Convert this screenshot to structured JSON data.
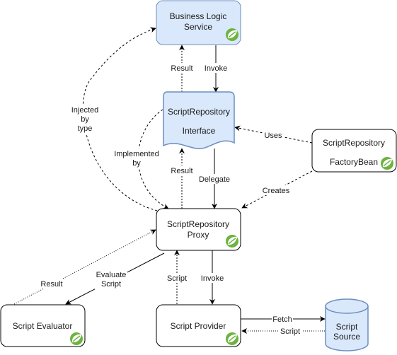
{
  "colors": {
    "blue_fill": "#dae8fc",
    "blue_stroke": "#6c8ebf",
    "white_fill": "#ffffff",
    "black_stroke": "#000000",
    "spring_green": "#6db33f"
  },
  "nodes": {
    "business_logic_service": {
      "line1": "Business Logic",
      "line2": "Service",
      "icon": "spring-leaf-icon"
    },
    "script_repository_interface": {
      "line1": "ScriptRepository",
      "line2": "Interface"
    },
    "script_repository_factory_bean": {
      "line1": "ScriptRepository",
      "line2": "FactoryBean",
      "icon": "spring-leaf-icon"
    },
    "script_repository_proxy": {
      "line1": "ScriptRepository",
      "line2": "Proxy",
      "icon": "spring-leaf-icon"
    },
    "script_evaluator": {
      "line1": "Script Evaluator",
      "icon": "spring-leaf-icon"
    },
    "script_provider": {
      "line1": "Script Provider",
      "icon": "spring-leaf-icon"
    },
    "script_source": {
      "line1": "Script",
      "line2": "Source"
    }
  },
  "edges": {
    "service_to_interface": {
      "label": "Invoke",
      "style": "solid"
    },
    "interface_to_service": {
      "label": "Result",
      "style": "dotted"
    },
    "interface_to_proxy": {
      "label": "Delegate",
      "style": "solid"
    },
    "proxy_to_interface": {
      "label": "Result",
      "style": "dotted"
    },
    "proxy_to_service": {
      "label_lines": [
        "Injected",
        "by",
        "type"
      ],
      "style": "dashed"
    },
    "interface_to_proxy_impl": {
      "label_lines": [
        "Implemented",
        "by"
      ],
      "style": "dashed"
    },
    "factory_to_interface": {
      "label": "Uses",
      "style": "dashed"
    },
    "factory_to_proxy": {
      "label": "Creates",
      "style": "dashed"
    },
    "proxy_to_evaluator": {
      "label_lines": [
        "Evaluate",
        "Script"
      ],
      "style": "solid"
    },
    "evaluator_to_proxy": {
      "label": "Result",
      "style": "dotted"
    },
    "proxy_to_provider": {
      "label": "Invoke",
      "style": "solid"
    },
    "provider_to_proxy": {
      "label": "Script",
      "style": "dotted"
    },
    "provider_to_source": {
      "label": "Fetch",
      "style": "solid"
    },
    "source_to_provider": {
      "label": "Script",
      "style": "dotted"
    }
  }
}
